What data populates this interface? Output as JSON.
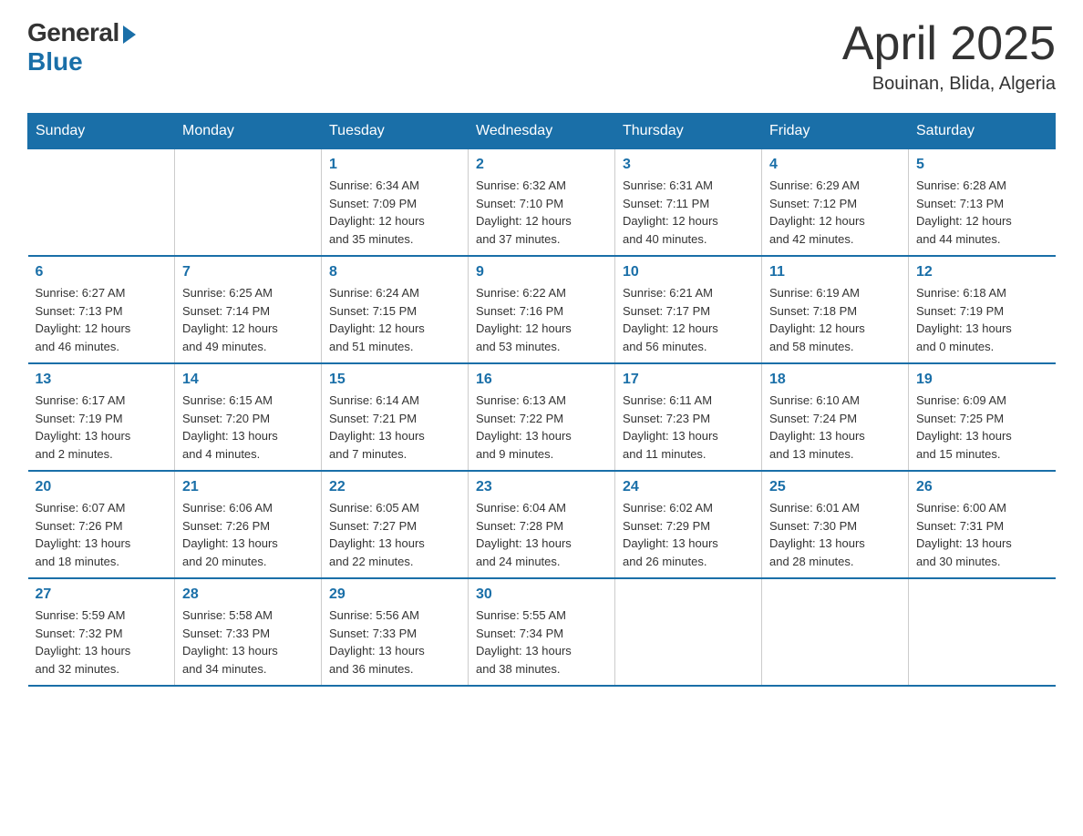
{
  "logo": {
    "general": "General",
    "blue": "Blue"
  },
  "header": {
    "month": "April 2025",
    "location": "Bouinan, Blida, Algeria"
  },
  "weekdays": [
    "Sunday",
    "Monday",
    "Tuesday",
    "Wednesday",
    "Thursday",
    "Friday",
    "Saturday"
  ],
  "weeks": [
    [
      {
        "day": "",
        "info": ""
      },
      {
        "day": "",
        "info": ""
      },
      {
        "day": "1",
        "info": "Sunrise: 6:34 AM\nSunset: 7:09 PM\nDaylight: 12 hours\nand 35 minutes."
      },
      {
        "day": "2",
        "info": "Sunrise: 6:32 AM\nSunset: 7:10 PM\nDaylight: 12 hours\nand 37 minutes."
      },
      {
        "day": "3",
        "info": "Sunrise: 6:31 AM\nSunset: 7:11 PM\nDaylight: 12 hours\nand 40 minutes."
      },
      {
        "day": "4",
        "info": "Sunrise: 6:29 AM\nSunset: 7:12 PM\nDaylight: 12 hours\nand 42 minutes."
      },
      {
        "day": "5",
        "info": "Sunrise: 6:28 AM\nSunset: 7:13 PM\nDaylight: 12 hours\nand 44 minutes."
      }
    ],
    [
      {
        "day": "6",
        "info": "Sunrise: 6:27 AM\nSunset: 7:13 PM\nDaylight: 12 hours\nand 46 minutes."
      },
      {
        "day": "7",
        "info": "Sunrise: 6:25 AM\nSunset: 7:14 PM\nDaylight: 12 hours\nand 49 minutes."
      },
      {
        "day": "8",
        "info": "Sunrise: 6:24 AM\nSunset: 7:15 PM\nDaylight: 12 hours\nand 51 minutes."
      },
      {
        "day": "9",
        "info": "Sunrise: 6:22 AM\nSunset: 7:16 PM\nDaylight: 12 hours\nand 53 minutes."
      },
      {
        "day": "10",
        "info": "Sunrise: 6:21 AM\nSunset: 7:17 PM\nDaylight: 12 hours\nand 56 minutes."
      },
      {
        "day": "11",
        "info": "Sunrise: 6:19 AM\nSunset: 7:18 PM\nDaylight: 12 hours\nand 58 minutes."
      },
      {
        "day": "12",
        "info": "Sunrise: 6:18 AM\nSunset: 7:19 PM\nDaylight: 13 hours\nand 0 minutes."
      }
    ],
    [
      {
        "day": "13",
        "info": "Sunrise: 6:17 AM\nSunset: 7:19 PM\nDaylight: 13 hours\nand 2 minutes."
      },
      {
        "day": "14",
        "info": "Sunrise: 6:15 AM\nSunset: 7:20 PM\nDaylight: 13 hours\nand 4 minutes."
      },
      {
        "day": "15",
        "info": "Sunrise: 6:14 AM\nSunset: 7:21 PM\nDaylight: 13 hours\nand 7 minutes."
      },
      {
        "day": "16",
        "info": "Sunrise: 6:13 AM\nSunset: 7:22 PM\nDaylight: 13 hours\nand 9 minutes."
      },
      {
        "day": "17",
        "info": "Sunrise: 6:11 AM\nSunset: 7:23 PM\nDaylight: 13 hours\nand 11 minutes."
      },
      {
        "day": "18",
        "info": "Sunrise: 6:10 AM\nSunset: 7:24 PM\nDaylight: 13 hours\nand 13 minutes."
      },
      {
        "day": "19",
        "info": "Sunrise: 6:09 AM\nSunset: 7:25 PM\nDaylight: 13 hours\nand 15 minutes."
      }
    ],
    [
      {
        "day": "20",
        "info": "Sunrise: 6:07 AM\nSunset: 7:26 PM\nDaylight: 13 hours\nand 18 minutes."
      },
      {
        "day": "21",
        "info": "Sunrise: 6:06 AM\nSunset: 7:26 PM\nDaylight: 13 hours\nand 20 minutes."
      },
      {
        "day": "22",
        "info": "Sunrise: 6:05 AM\nSunset: 7:27 PM\nDaylight: 13 hours\nand 22 minutes."
      },
      {
        "day": "23",
        "info": "Sunrise: 6:04 AM\nSunset: 7:28 PM\nDaylight: 13 hours\nand 24 minutes."
      },
      {
        "day": "24",
        "info": "Sunrise: 6:02 AM\nSunset: 7:29 PM\nDaylight: 13 hours\nand 26 minutes."
      },
      {
        "day": "25",
        "info": "Sunrise: 6:01 AM\nSunset: 7:30 PM\nDaylight: 13 hours\nand 28 minutes."
      },
      {
        "day": "26",
        "info": "Sunrise: 6:00 AM\nSunset: 7:31 PM\nDaylight: 13 hours\nand 30 minutes."
      }
    ],
    [
      {
        "day": "27",
        "info": "Sunrise: 5:59 AM\nSunset: 7:32 PM\nDaylight: 13 hours\nand 32 minutes."
      },
      {
        "day": "28",
        "info": "Sunrise: 5:58 AM\nSunset: 7:33 PM\nDaylight: 13 hours\nand 34 minutes."
      },
      {
        "day": "29",
        "info": "Sunrise: 5:56 AM\nSunset: 7:33 PM\nDaylight: 13 hours\nand 36 minutes."
      },
      {
        "day": "30",
        "info": "Sunrise: 5:55 AM\nSunset: 7:34 PM\nDaylight: 13 hours\nand 38 minutes."
      },
      {
        "day": "",
        "info": ""
      },
      {
        "day": "",
        "info": ""
      },
      {
        "day": "",
        "info": ""
      }
    ]
  ]
}
